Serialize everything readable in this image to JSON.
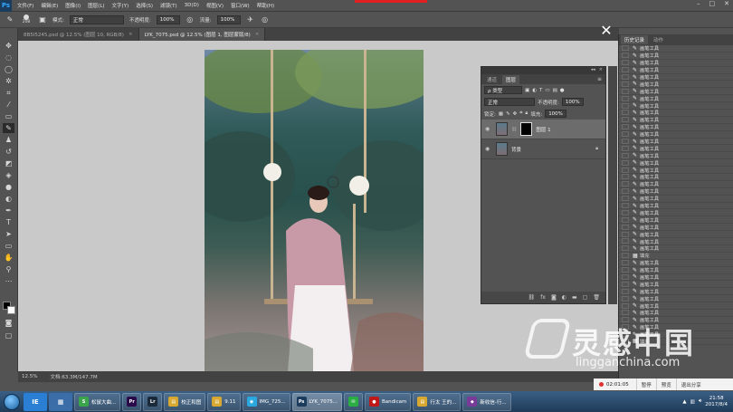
{
  "app": {
    "logo": "Ps",
    "menus": [
      "文件(F)",
      "编辑(E)",
      "图像(I)",
      "图层(L)",
      "文字(Y)",
      "选择(S)",
      "滤镜(T)",
      "3D(D)",
      "视图(V)",
      "窗口(W)",
      "帮助(H)"
    ],
    "window_controls": [
      "–",
      "□",
      "✕"
    ]
  },
  "options_bar": {
    "brush_size": "208",
    "mode_label": "模式:",
    "mode_value": "正常",
    "opacity_label": "不透明度:",
    "opacity_value": "100%",
    "flow_label": "流量:",
    "flow_value": "100%"
  },
  "doc_tabs": [
    {
      "label": "8B5I5245.psd @ 12.5% (图层 10, RGB/8)",
      "active": false
    },
    {
      "label": "LYK_7075.psd @ 12.5% (图层 1, 图层蒙版/8)",
      "active": true
    }
  ],
  "status": {
    "zoom": "12.5%",
    "doc_size": "文档:63.3M/147.7M"
  },
  "layers_panel": {
    "tabs": [
      "通道",
      "图层"
    ],
    "active_tab": "图层",
    "filter_label": "ρ 类型",
    "blend_mode": "正常",
    "opacity_label": "不透明度:",
    "opacity_value": "100%",
    "lock_label": "锁定:",
    "fill_label": "填充:",
    "fill_value": "100%",
    "layers": [
      {
        "name": "图层 1",
        "selected": true,
        "has_mask": true
      },
      {
        "name": "背景",
        "selected": false,
        "locked": true
      }
    ],
    "footer_icons": [
      "link-icon",
      "fx-icon",
      "mask-icon",
      "adjustment-icon",
      "folder-icon",
      "new-layer-icon",
      "trash-icon"
    ]
  },
  "history_panel": {
    "tabs": [
      "历史记录",
      "动作"
    ],
    "active_tab": "历史记录",
    "items": [
      "画笔工具",
      "画笔工具",
      "画笔工具",
      "画笔工具",
      "画笔工具",
      "画笔工具",
      "画笔工具",
      "画笔工具",
      "画笔工具",
      "画笔工具",
      "画笔工具",
      "画笔工具",
      "画笔工具",
      "画笔工具",
      "画笔工具",
      "画笔工具",
      "画笔工具",
      "画笔工具",
      "画笔工具",
      "画笔工具",
      "画笔工具",
      "画笔工具",
      "画笔工具",
      "画笔工具",
      "画笔工具",
      "画笔工具",
      "画笔工具",
      "画笔工具",
      "画笔工具",
      "填充",
      "画笔工具",
      "画笔工具",
      "画笔工具",
      "画笔工具",
      "画笔工具",
      "画笔工具",
      "画笔工具",
      "画笔工具",
      "画笔工具",
      "画笔工具",
      "画笔工具",
      "填充"
    ]
  },
  "watermark": {
    "cn": "灵感中国",
    "en": "lingganchina.com"
  },
  "recorder": {
    "time": "02:01:05",
    "buttons": [
      "暂停",
      "预览",
      "退出分享"
    ]
  },
  "taskbar": {
    "pinned": [
      {
        "label": "IE",
        "color": "#2a7fd4"
      },
      {
        "label": "▦",
        "color": "#3b6ea8"
      }
    ],
    "items": [
      {
        "label": "松鼠大曲...",
        "icon": "S",
        "color": "#3aa54a"
      },
      {
        "label": "",
        "icon": "Pr",
        "color": "#2b0a4a"
      },
      {
        "label": "",
        "icon": "Lr",
        "color": "#1b2a3a"
      },
      {
        "label": "校正和图",
        "icon": "▤",
        "color": "#d8a830"
      },
      {
        "label": "9.11",
        "icon": "▤",
        "color": "#d8a830"
      },
      {
        "label": "IMG_725...",
        "icon": "◉",
        "color": "#2aa8e0"
      },
      {
        "label": "LYK_7075...",
        "icon": "Ps",
        "color": "#1c3c5e",
        "active": true
      },
      {
        "label": "",
        "icon": "✉",
        "color": "#2aae44"
      },
      {
        "label": "Bandicam",
        "icon": "●",
        "color": "#c01818"
      },
      {
        "label": "行太 王的...",
        "icon": "▤",
        "color": "#d8a830"
      },
      {
        "label": "新收信-行...",
        "icon": "◆",
        "color": "#7a3a9a"
      }
    ],
    "clock_time": "21:58",
    "clock_date": "2017/8/4"
  }
}
